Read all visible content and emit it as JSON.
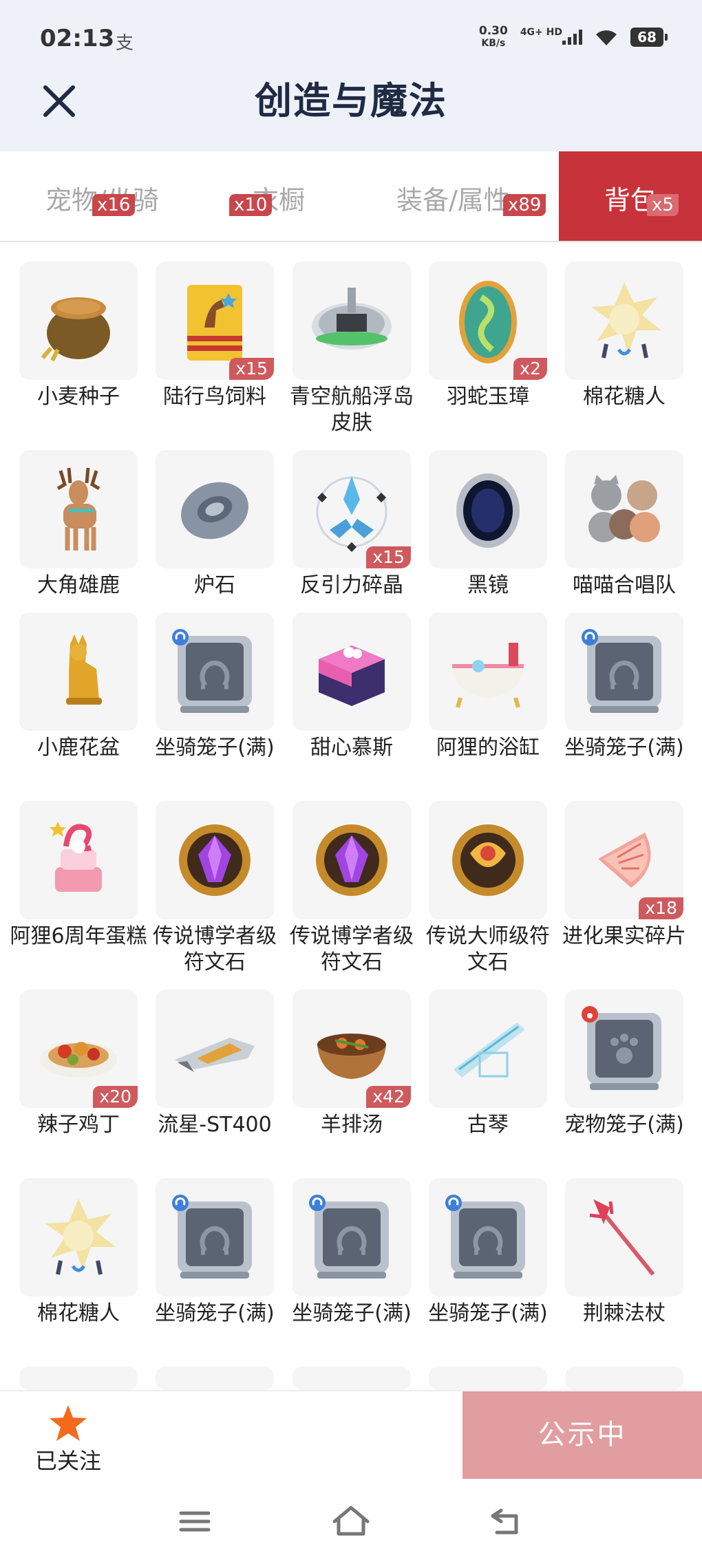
{
  "status_bar": {
    "time": "02:13",
    "extra": "支",
    "net_speed_value": "0.30",
    "net_speed_unit": "KB/s",
    "network": "4G+ HD",
    "battery": "68"
  },
  "header": {
    "title": "创造与魔法"
  },
  "tabs": [
    {
      "label": "宠物/坐骑",
      "badge": "x16",
      "active": false
    },
    {
      "label": "衣橱",
      "badge": "x10",
      "active": false
    },
    {
      "label": "装备/属性",
      "badge": "x89",
      "active": false
    },
    {
      "label": "背包",
      "badge": "x5",
      "active": true
    }
  ],
  "items": [
    {
      "name": "小麦种子",
      "icon": "wheat-sack-icon",
      "qty": ""
    },
    {
      "name": "陆行鸟饲料",
      "icon": "bird-feed-bag-icon",
      "qty": "x15"
    },
    {
      "name": "青空航船浮岛皮肤",
      "icon": "floating-island-icon",
      "qty": ""
    },
    {
      "name": "羽蛇玉璋",
      "icon": "jade-serpent-egg-icon",
      "qty": "x2"
    },
    {
      "name": "棉花糖人",
      "icon": "cotton-candy-creature-icon",
      "qty": ""
    },
    {
      "name": "大角雄鹿",
      "icon": "great-stag-icon",
      "qty": ""
    },
    {
      "name": "炉石",
      "icon": "hearthstone-icon",
      "qty": ""
    },
    {
      "name": "反引力碎晶",
      "icon": "antigravity-crystal-icon",
      "qty": "x15"
    },
    {
      "name": "黑镜",
      "icon": "black-mirror-icon",
      "qty": ""
    },
    {
      "name": "喵喵合唱队",
      "icon": "cat-choir-icon",
      "qty": ""
    },
    {
      "name": "小鹿花盆",
      "icon": "deer-flowerpot-icon",
      "qty": ""
    },
    {
      "name": "坐骑笼子(满)",
      "icon": "mount-cage-icon",
      "qty": ""
    },
    {
      "name": "甜心慕斯",
      "icon": "mousse-cake-icon",
      "qty": ""
    },
    {
      "name": "阿狸的浴缸",
      "icon": "bathtub-icon",
      "qty": ""
    },
    {
      "name": "坐骑笼子(满)",
      "icon": "mount-cage-icon",
      "qty": ""
    },
    {
      "name": "阿狸6周年蛋糕",
      "icon": "anniversary-cake-icon",
      "qty": ""
    },
    {
      "name": "传说博学者级符文石",
      "icon": "rune-stone-purple-icon",
      "qty": ""
    },
    {
      "name": "传说博学者级符文石",
      "icon": "rune-stone-purple-icon",
      "qty": ""
    },
    {
      "name": "传说大师级符文石",
      "icon": "rune-stone-gold-icon",
      "qty": ""
    },
    {
      "name": "进化果实碎片",
      "icon": "fruit-shard-icon",
      "qty": "x18"
    },
    {
      "name": "辣子鸡丁",
      "icon": "spicy-chicken-icon",
      "qty": "x20"
    },
    {
      "name": "流星-ST400",
      "icon": "meteor-ship-icon",
      "qty": ""
    },
    {
      "name": "羊排汤",
      "icon": "lamb-soup-icon",
      "qty": "x42"
    },
    {
      "name": "古琴",
      "icon": "guqin-icon",
      "qty": ""
    },
    {
      "name": "宠物笼子(满)",
      "icon": "pet-cage-icon",
      "qty": ""
    },
    {
      "name": "棉花糖人",
      "icon": "cotton-candy-creature-icon",
      "qty": ""
    },
    {
      "name": "坐骑笼子(满)",
      "icon": "mount-cage-icon",
      "qty": ""
    },
    {
      "name": "坐骑笼子(满)",
      "icon": "mount-cage-icon",
      "qty": ""
    },
    {
      "name": "坐骑笼子(满)",
      "icon": "mount-cage-icon",
      "qty": ""
    },
    {
      "name": "荆棘法杖",
      "icon": "thorn-staff-icon",
      "qty": ""
    }
  ],
  "bottom_bar": {
    "follow_label": "已关注",
    "cta_label": "公示中"
  },
  "nav_bar": {
    "menu_icon": "menu-icon",
    "home_icon": "home-icon",
    "back_icon": "back-icon"
  },
  "colors": {
    "accent": "#c8323a",
    "badge": "#cf5a5e",
    "cta": "#e19da0",
    "star": "#f36a1c"
  }
}
